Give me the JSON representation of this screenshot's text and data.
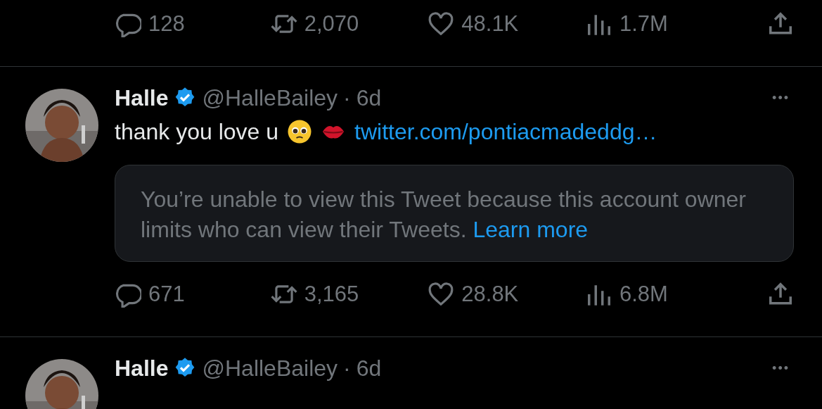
{
  "top_actions": [
    {
      "kind": "reply",
      "count": "128"
    },
    {
      "kind": "retweet",
      "count": "2,070"
    },
    {
      "kind": "like",
      "count": "48.1K"
    },
    {
      "kind": "views",
      "count": "1.7M"
    },
    {
      "kind": "share"
    }
  ],
  "tweets": [
    {
      "author": "Halle",
      "verified": true,
      "handle": "@HalleBailey",
      "separator": "·",
      "time": "6d",
      "more": "•••",
      "text": "thank you love u",
      "emojis": [
        {
          "kind": "pleading"
        },
        {
          "kind": "kiss"
        }
      ],
      "link": "twitter.com/pontiacmadeddg…",
      "quote": {
        "text": "You’re unable to view this Tweet because this account owner limits who can view their Tweets.",
        "link": "Learn more"
      },
      "actions": [
        {
          "kind": "reply",
          "count": "671"
        },
        {
          "kind": "retweet",
          "count": "3,165"
        },
        {
          "kind": "like",
          "count": "28.8K"
        },
        {
          "kind": "views",
          "count": "6.8M"
        },
        {
          "kind": "share"
        }
      ]
    },
    {
      "author": "Halle",
      "verified": true,
      "handle": "@HalleBailey",
      "separator": "·",
      "time": "6d",
      "more": "•••"
    }
  ]
}
